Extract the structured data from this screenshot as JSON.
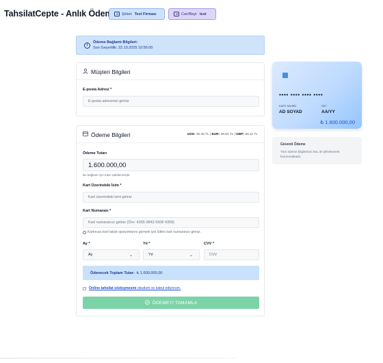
{
  "header": {
    "title": "TahsilatCepte - Anlık Ödeme",
    "company_label": "Şirket:",
    "company_value": "Test Firması",
    "dealer_label": "Cari/Bayi:",
    "dealer_value": "test"
  },
  "link_info": {
    "title": "Ödeme Bağlantı Bilgileri:",
    "validity": "Son Geçerlilik: 22.10.2025 10:56:00"
  },
  "customer": {
    "title": "Müşteri Bilgileri",
    "email_label": "E-posta Adresi *",
    "email_placeholder": "E-posta adresinizi giriniz"
  },
  "payment": {
    "title": "Ödeme Bilgileri",
    "rate_usd_label": "USD:",
    "rate_usd": "45.45 TL",
    "rate_eur_label": "EUR:",
    "rate_eur": "48.84 TL",
    "rate_gbp_label": "GBP:",
    "rate_gbp": "56.11 TL",
    "amount_label": "Ödeme Tutarı",
    "amount_value": "1.600.000,00",
    "amount_hint": "Bu bağlantı için tutar sabitlenmiştir.",
    "holder_label": "Kart Üzerindeki İsim *",
    "holder_placeholder": "Kart üzerindeki ismi giriniz",
    "number_label": "Kart Numarası *",
    "number_placeholder": "Kart numaranızı giriniz (Örn: 4355 0843 5508 4358)",
    "installment_hint": "Kartınıza özel taksit opsiyonlarını görmek için lütfen kart numaranızı giriniz.",
    "month_label": "Ay *",
    "month_value": "Ay",
    "year_label": "Yıl *",
    "year_value": "Yıl",
    "cvv_label": "CVV *",
    "cvv_placeholder": "CVV",
    "total_label": "Ödenecek Toplam Tutar:",
    "total_value": "₺ 1.600.000,00",
    "terms_link": "Online tahsilat sözleşmesini",
    "terms_rest": " okudum ve kabul ediyorum.",
    "submit_label": "ÖDEMEYİ TAMAMLA"
  },
  "card_preview": {
    "number": "•••• •••• •••• ••••",
    "holder_label": "KART SAHİBİ",
    "holder_value": "AD SOYAD",
    "expiry_label": "SKT",
    "expiry_value": "AA/YY",
    "amount": "₺ 1.600.000,00"
  },
  "secure": {
    "title": "Güvenli Ödeme",
    "text": "Tüm ödeme bilgileriniz SSL ile şifrelenerek korunmaktadır."
  },
  "colors": {
    "info_bg": "#cfe4fb",
    "company_badge": "#cfe2fb",
    "dealer_badge": "#ddd6f7",
    "submit_bg": "#7dd3a8",
    "accent": "#1d4ed8"
  },
  "icons": [
    "info-icon",
    "user-icon",
    "credit-card-icon",
    "building-icon",
    "id-card-icon",
    "chevron-down-icon",
    "check-circle-icon"
  ]
}
